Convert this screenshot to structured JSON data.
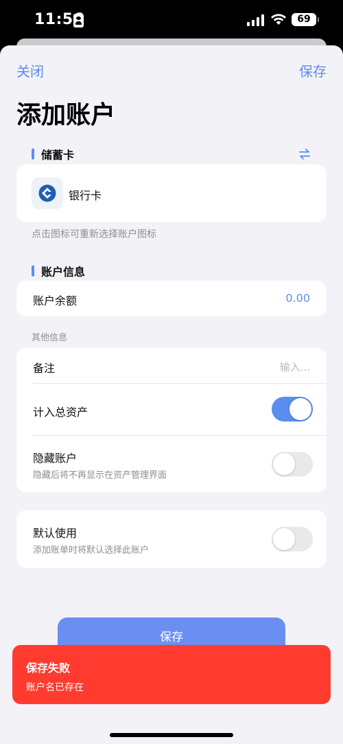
{
  "status_bar": {
    "time": "11:56",
    "battery": "69"
  },
  "nav": {
    "close_label": "关闭",
    "save_label": "保存"
  },
  "page": {
    "title": "添加账户"
  },
  "account_type": {
    "section_label": "储蓄卡",
    "bank_name": "银行卡",
    "hint": "点击图标可重新选择账户图标"
  },
  "account_info": {
    "section_label": "账户信息",
    "balance_label": "账户余额",
    "balance_value": "0.00"
  },
  "other_info": {
    "section_label": "其他信息",
    "note_label": "备注",
    "note_placeholder": "输入...",
    "include_total_label": "计入总资产",
    "include_total_on": true,
    "hide_label": "隐藏账户",
    "hide_sub": "隐藏后将不再显示在资产管理界面",
    "hide_on": false
  },
  "default_card": {
    "label": "默认使用",
    "sub": "添加账单时将默认选择此账户",
    "on": false
  },
  "save_button": {
    "label": "保存"
  },
  "toast": {
    "title": "保存失败",
    "message": "账户名已存在"
  },
  "colors": {
    "accent": "#5b8def",
    "error": "#ff3b30",
    "background": "#f2f2f7"
  },
  "icons": {
    "bank_logo": "ccb-bank-logo",
    "swap": "swap-arrows-icon"
  }
}
